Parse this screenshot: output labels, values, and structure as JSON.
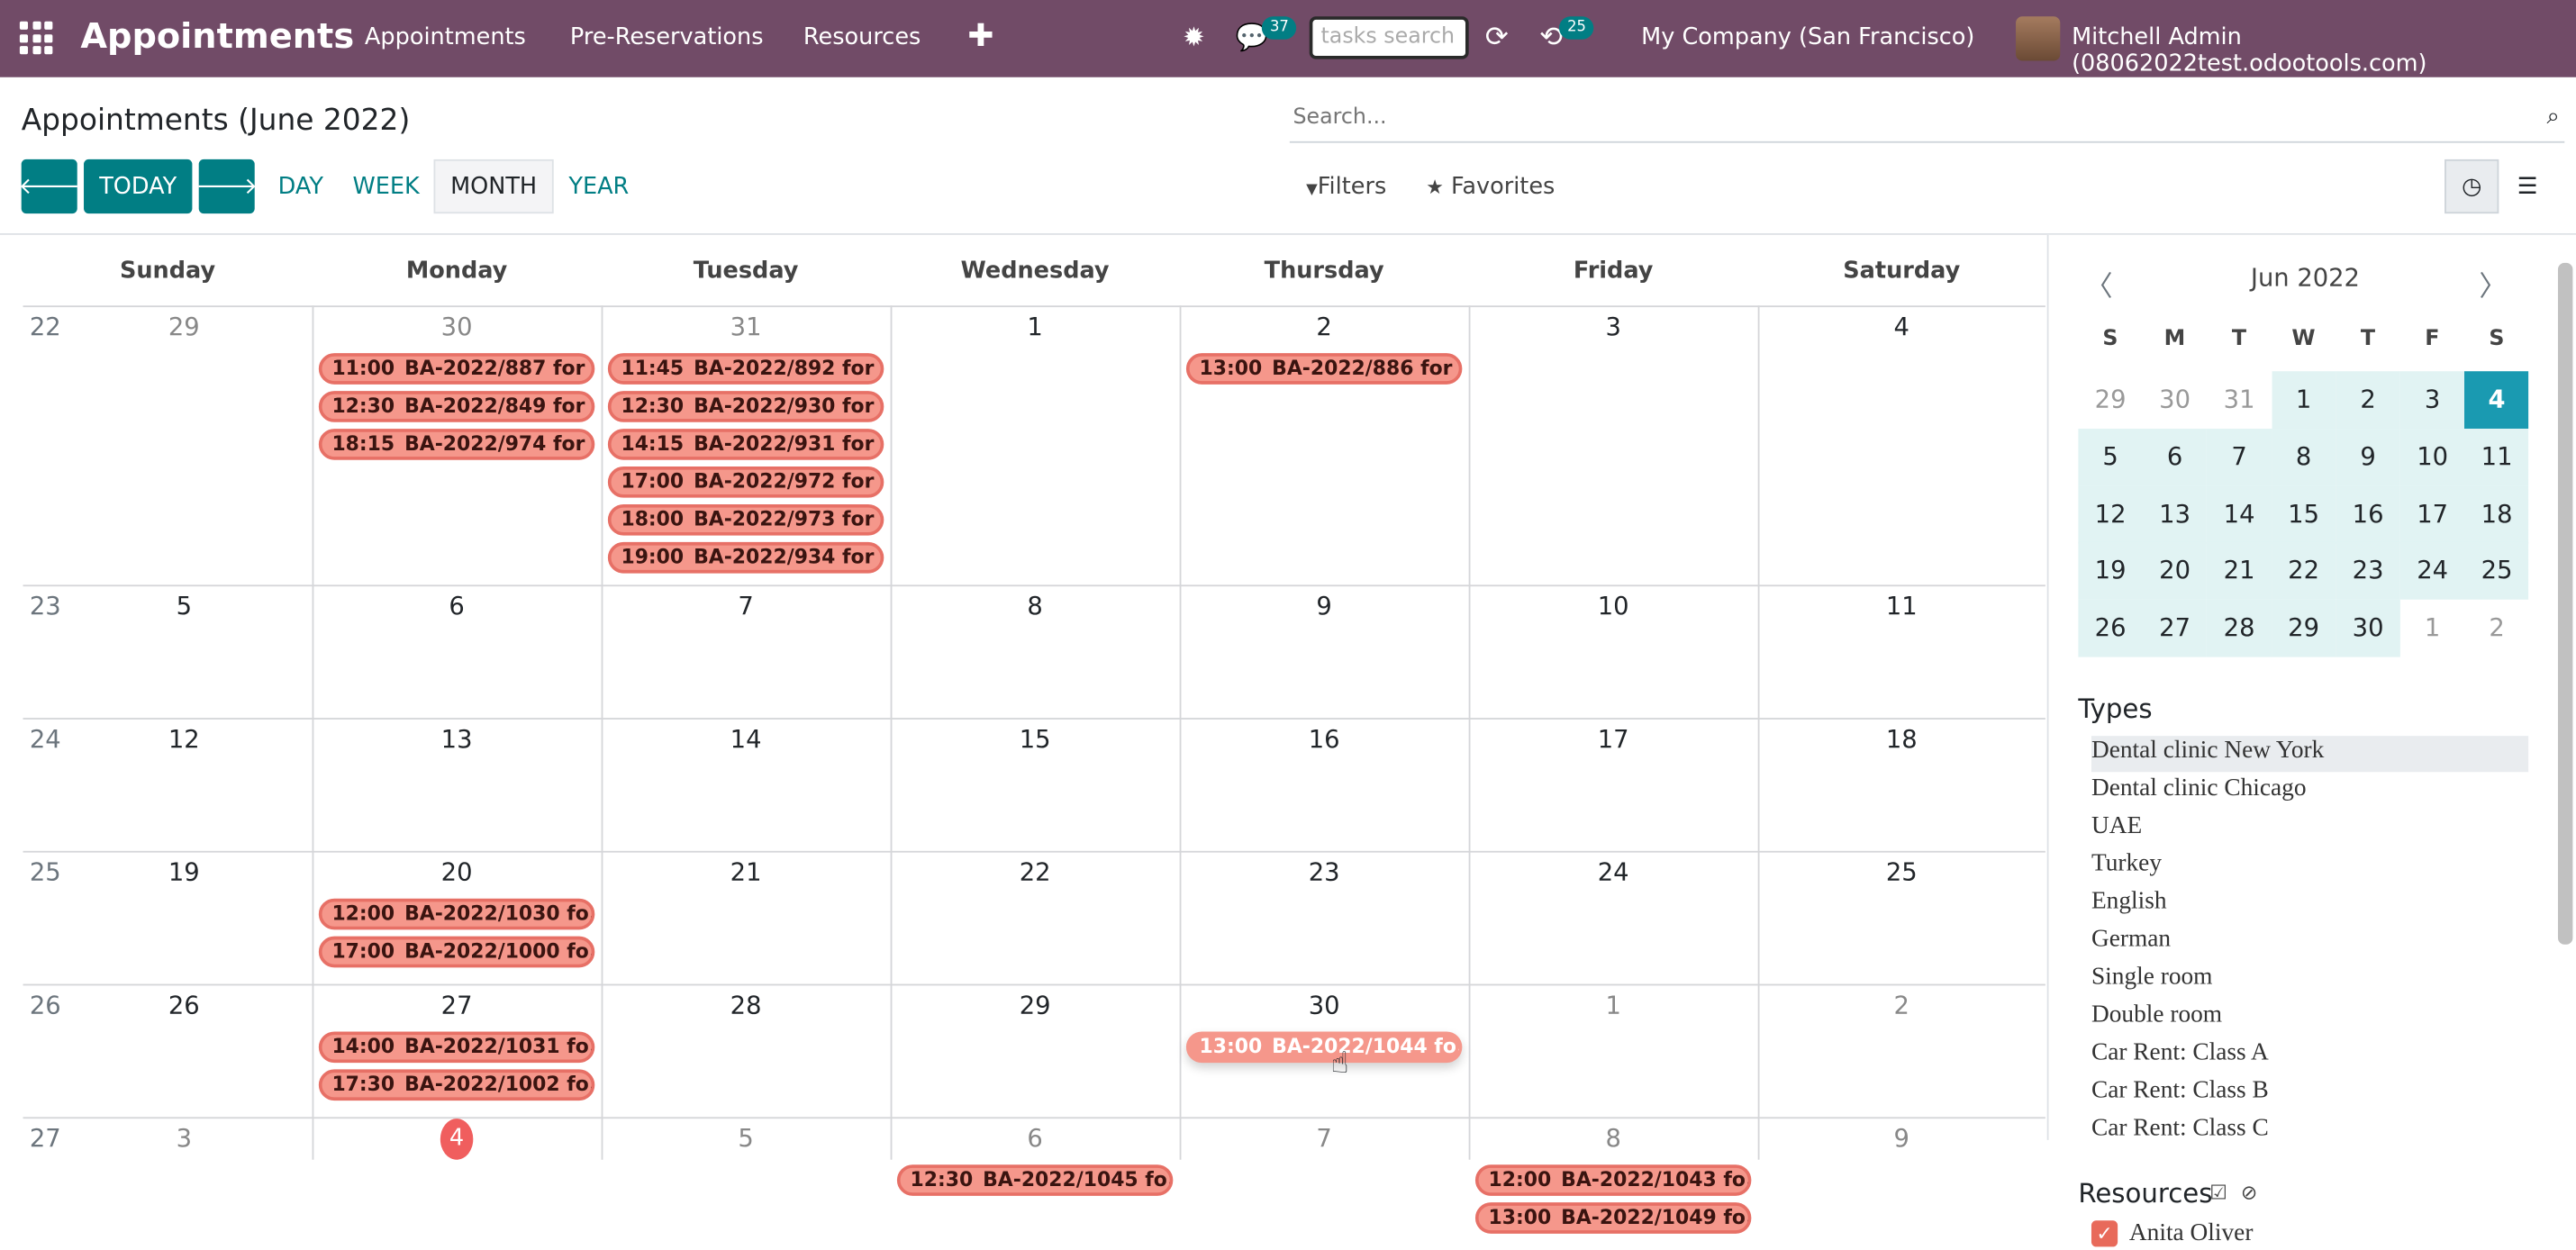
{
  "navbar": {
    "brand": "Appointments",
    "menu": [
      "Appointments",
      "Pre-Reservations",
      "Resources"
    ],
    "plus": "✚",
    "bug_icon": "✹",
    "chat_icon": "💬",
    "chat_count": "37",
    "tasks_placeholder": "tasks search",
    "refresh_icon": "⟳",
    "activity_icon": "⟲",
    "activity_count": "25",
    "company": "My Company (San Francisco)",
    "user": "Mitchell Admin (08062022test.odootools.com)"
  },
  "control": {
    "title": "Appointments (June 2022)",
    "search_placeholder": "Search...",
    "search_icon": "⌕",
    "prev_icon": "🡐",
    "today": "TODAY",
    "next_icon": "🡒",
    "scales": [
      "DAY",
      "WEEK",
      "MONTH",
      "YEAR"
    ],
    "active_scale": "MONTH",
    "filters": "Filters",
    "filter_icon": "▼",
    "favorites": "Favorites",
    "favorite_icon": "★",
    "calendar_view_icon": "◷",
    "list_view_icon": "☰"
  },
  "calendar": {
    "weekdays": [
      "Sunday",
      "Monday",
      "Tuesday",
      "Wednesday",
      "Thursday",
      "Friday",
      "Saturday"
    ],
    "weeks": [
      {
        "num": "22",
        "days": [
          "29",
          "30",
          "31",
          "1",
          "2",
          "3",
          "4"
        ]
      },
      {
        "num": "23",
        "days": [
          "5",
          "6",
          "7",
          "8",
          "9",
          "10",
          "11"
        ]
      },
      {
        "num": "24",
        "days": [
          "12",
          "13",
          "14",
          "15",
          "16",
          "17",
          "18"
        ]
      },
      {
        "num": "25",
        "days": [
          "19",
          "20",
          "21",
          "22",
          "23",
          "24",
          "25"
        ]
      },
      {
        "num": "26",
        "days": [
          "26",
          "27",
          "28",
          "29",
          "30",
          "1",
          "2"
        ]
      },
      {
        "num": "27",
        "days": [
          "3",
          "4",
          "5",
          "6",
          "7",
          "8",
          "9"
        ]
      }
    ],
    "today_label": "4",
    "events": [
      {
        "week": 0,
        "day": 1,
        "slot": 0,
        "time": "11:00",
        "label": "BA-2022/887 for ..."
      },
      {
        "week": 0,
        "day": 1,
        "slot": 1,
        "time": "12:30",
        "label": "BA-2022/849 for ..."
      },
      {
        "week": 0,
        "day": 1,
        "slot": 2,
        "time": "18:15",
        "label": "BA-2022/974 for ..."
      },
      {
        "week": 0,
        "day": 2,
        "slot": 0,
        "time": "11:45",
        "label": "BA-2022/892 for ..."
      },
      {
        "week": 0,
        "day": 2,
        "slot": 1,
        "time": "12:30",
        "label": "BA-2022/930 for ..."
      },
      {
        "week": 0,
        "day": 2,
        "slot": 2,
        "time": "14:15",
        "label": "BA-2022/931 for ..."
      },
      {
        "week": 0,
        "day": 2,
        "slot": 3,
        "time": "17:00",
        "label": "BA-2022/972 for ..."
      },
      {
        "week": 0,
        "day": 2,
        "slot": 4,
        "time": "18:00",
        "label": "BA-2022/973 for ..."
      },
      {
        "week": 0,
        "day": 2,
        "slot": 5,
        "time": "19:00",
        "label": "BA-2022/934 for ..."
      },
      {
        "week": 0,
        "day": 4,
        "slot": 0,
        "time": "13:00",
        "label": "BA-2022/886 for ..."
      },
      {
        "week": 3,
        "day": 1,
        "slot": 0,
        "time": "12:00",
        "label": "BA-2022/1030 fo..."
      },
      {
        "week": 3,
        "day": 1,
        "slot": 1,
        "time": "17:00",
        "label": "BA-2022/1000 fo..."
      },
      {
        "week": 4,
        "day": 1,
        "slot": 0,
        "time": "14:00",
        "label": "BA-2022/1031 fo..."
      },
      {
        "week": 4,
        "day": 1,
        "slot": 1,
        "time": "17:30",
        "label": "BA-2022/1002 fo..."
      },
      {
        "week": 4,
        "day": 4,
        "slot": 0,
        "time": "13:00",
        "label": "BA-2022/1044 fo...",
        "hover": true
      },
      {
        "week": 5,
        "day": 3,
        "slot": 0,
        "time": "12:30",
        "label": "BA-2022/1045 fo..."
      },
      {
        "week": 5,
        "day": 5,
        "slot": 0,
        "time": "12:00",
        "label": "BA-2022/1043 fo..."
      },
      {
        "week": 5,
        "day": 5,
        "slot": 1,
        "time": "13:00",
        "label": "BA-2022/1049 fo..."
      }
    ]
  },
  "mini_calendar": {
    "header": "Jun 2022",
    "prev_icon": "〈",
    "next_icon": "〉",
    "weekday_initials": [
      "S",
      "M",
      "T",
      "W",
      "T",
      "F",
      "S"
    ],
    "weeks": [
      [
        "29",
        "30",
        "31",
        "1",
        "2",
        "3",
        "4"
      ],
      [
        "5",
        "6",
        "7",
        "8",
        "9",
        "10",
        "11"
      ],
      [
        "12",
        "13",
        "14",
        "15",
        "16",
        "17",
        "18"
      ],
      [
        "19",
        "20",
        "21",
        "22",
        "23",
        "24",
        "25"
      ],
      [
        "26",
        "27",
        "28",
        "29",
        "30",
        "1",
        "2"
      ]
    ],
    "selected": "4"
  },
  "types": {
    "heading": "Types",
    "items": [
      "Dental clinic New York",
      "Dental clinic Chicago",
      "UAE",
      "Turkey",
      "English",
      "German",
      "Single room",
      "Double room",
      "Car Rent: Class A",
      "Car Rent: Class B",
      "Car Rent: Class C"
    ]
  },
  "resources": {
    "heading": "Resources",
    "select_all_icon": "☑",
    "clear_icon": "⊘",
    "check_icon": "✓",
    "items": [
      "Anita Oliver"
    ]
  }
}
